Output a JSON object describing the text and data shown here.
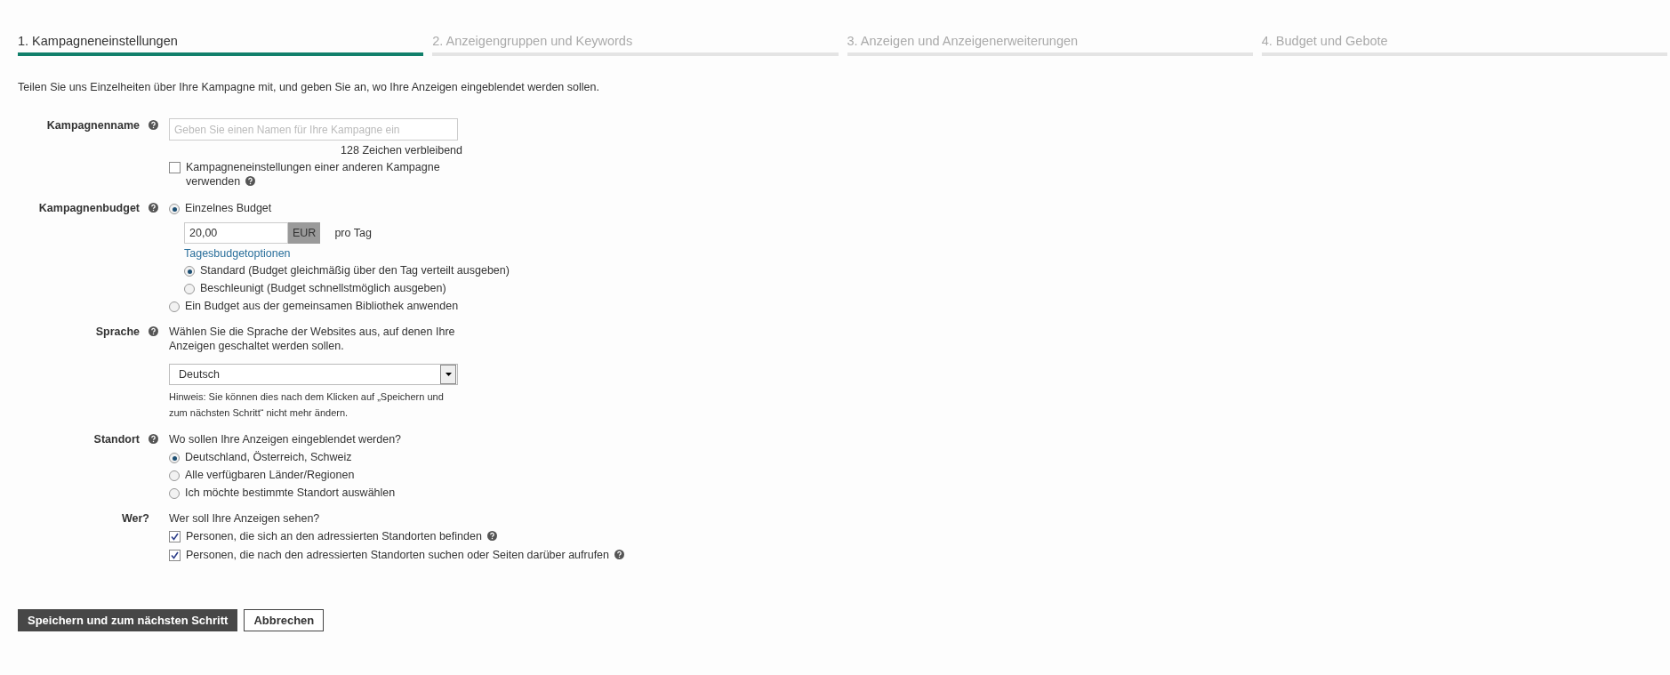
{
  "steps": [
    {
      "label": "1. Kampagneneinstellungen",
      "selected": true
    },
    {
      "label": "2. Anzeigengruppen und Keywords",
      "selected": false
    },
    {
      "label": "3. Anzeigen und Anzeigenerweiterungen",
      "selected": false
    },
    {
      "label": "4. Budget und Gebote",
      "selected": false
    }
  ],
  "intro": "Teilen Sie uns Einzelheiten über Ihre Kampagne mit, und geben Sie an, wo Ihre Anzeigen eingeblendet werden sollen.",
  "sections": [
    {
      "kind": "name",
      "label": "Kampagnenname",
      "help": true,
      "items": [
        {
          "kind": "input",
          "placeholder": "Geben Sie einen Namen für Ihre Kampagne ein"
        },
        {
          "kind": "counter",
          "text": "128 Zeichen verbleibend"
        },
        {
          "kind": "checkbox",
          "label": "Kampagneneinstellungen einer anderen Kampagne verwenden",
          "checked": false,
          "help": true
        }
      ]
    },
    {
      "kind": "budget",
      "label": "Kampagnenbudget",
      "help": true,
      "items": [
        {
          "kind": "radio",
          "label": "Einzelnes Budget",
          "selected": true,
          "children": [
            {
              "kind": "money",
              "value": "20,00",
              "currency": "EUR",
              "suffix": "pro Tag"
            },
            {
              "kind": "link",
              "text": "Tagesbudgetoptionen"
            },
            {
              "kind": "radio",
              "label": "Standard (Budget gleichmäßig über den Tag verteilt ausgeben)",
              "selected": true
            },
            {
              "kind": "radio",
              "label": "Beschleunigt (Budget schnellstmöglich ausgeben)",
              "selected": false
            }
          ]
        },
        {
          "kind": "radio",
          "label": "Ein Budget aus der gemeinsamen Bibliothek anwenden",
          "selected": false
        }
      ]
    },
    {
      "kind": "language",
      "label": "Sprache",
      "help": true,
      "items": [
        {
          "kind": "text",
          "text": "Wählen Sie die Sprache der Websites aus, auf denen Ihre Anzeigen geschaltet werden sollen."
        },
        {
          "kind": "select",
          "value": "Deutsch"
        },
        {
          "kind": "hint",
          "text": "Hinweis: Sie können dies nach dem Klicken auf „Speichern und zum nächsten Schritt“ nicht mehr ändern."
        }
      ]
    },
    {
      "kind": "location",
      "label": "Standort",
      "help": true,
      "items": [
        {
          "kind": "text",
          "text": "Wo sollen Ihre Anzeigen eingeblendet werden?"
        },
        {
          "kind": "radio",
          "label": "Deutschland, Österreich, Schweiz",
          "selected": true
        },
        {
          "kind": "radio",
          "label": "Alle verfügbaren Länder/Regionen",
          "selected": false
        },
        {
          "kind": "radio",
          "label": "Ich möchte bestimmte Standort auswählen",
          "selected": false
        }
      ]
    },
    {
      "kind": "audience",
      "label": "Wer?",
      "help": false,
      "items": [
        {
          "kind": "text",
          "text": "Wer soll Ihre Anzeigen sehen?"
        },
        {
          "kind": "checkbox",
          "label": "Personen, die sich an den adressierten Standorten befinden",
          "checked": true,
          "help": true
        },
        {
          "kind": "checkbox",
          "label": "Personen, die nach den adressierten Standorten suchen oder Seiten darüber aufrufen",
          "checked": true,
          "help": true
        }
      ]
    }
  ],
  "buttons": [
    {
      "kind": "primary",
      "label": "Speichern und zum nächsten Schritt"
    },
    {
      "kind": "secondary",
      "label": "Abbrechen"
    }
  ]
}
